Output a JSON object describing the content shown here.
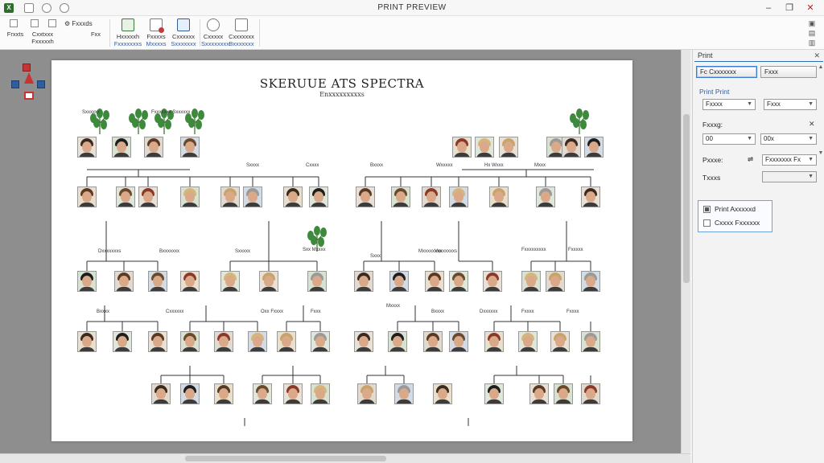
{
  "window": {
    "title": "PRINT PREVIEW",
    "controls": [
      "–",
      "❐",
      "✕"
    ]
  },
  "ribbon": {
    "quick": [
      "Fxxxds"
    ],
    "buttons": [
      {
        "label": "Frxxts",
        "sub": ""
      },
      {
        "label": "Cxxtxxx",
        "sub": "Fxxxxxh"
      },
      {
        "label": "Fxx",
        "sub": ""
      },
      {
        "label": "Hxxxxxh",
        "sub": "Fxxxxxxxs"
      },
      {
        "label": "Fxxxxs",
        "sub": "Mxxxxs"
      },
      {
        "label": "Cxxxxxx",
        "sub": "Sxxxxxxx"
      },
      {
        "label": "Cxxxxx",
        "sub": "Sxxxxxxxx"
      },
      {
        "label": "Cxxxxxxx",
        "sub": "Bxxxxxxx"
      }
    ]
  },
  "page": {
    "title": "SKERUUE ATS SPECTRA",
    "subtitle": "Enxxxxxxxxxs",
    "labels": [
      "Sxxxxxx",
      "Fxxxxxxx Sxxxxxx",
      "Sxxxx",
      "Cxxxx",
      "Dxxxxxxxs",
      "Bxxxxxxx",
      "Sxxxxx",
      "Sxx Mxxxx",
      "Bxxxx",
      "Wxxxxx",
      "Hx Wxxx",
      "Mxxx",
      "Sxxx",
      "Mxxxxxxxx",
      "Vxxxxxxxs",
      "Fxxxxxxxxx",
      "Fxxxxx",
      "Bxxxx",
      "Cxxxxxx",
      "Oxx Fxxxx",
      "Fxxx",
      "Mxxxx",
      "Bxxxx",
      "Dxxxxxx",
      "Fxxxx",
      "Fxxxx"
    ]
  },
  "panel": {
    "title": "Print",
    "close": "✕",
    "btn_print": "Fc",
    "btn_preview": "Cxxxxxxx",
    "btn_setup": "Fxxx",
    "section": "Print Print",
    "dd1": "Fxxxx",
    "dd2": "Fxxx",
    "label_range": "Fxxxg:",
    "dd3": "00",
    "dd4": "00x",
    "label_pages": "Pxxxe:",
    "dd5": "Fxxxxxxx Fx",
    "label_topics": "Txxxs",
    "dd6": "",
    "opt1": "Print Axxxxxd",
    "opt2": "Cxxxx Fxxxxxx"
  },
  "colors": {
    "accent": "#2f6fb5",
    "workspace": "#8e8e8e",
    "leaf": "#3d8a3d"
  }
}
